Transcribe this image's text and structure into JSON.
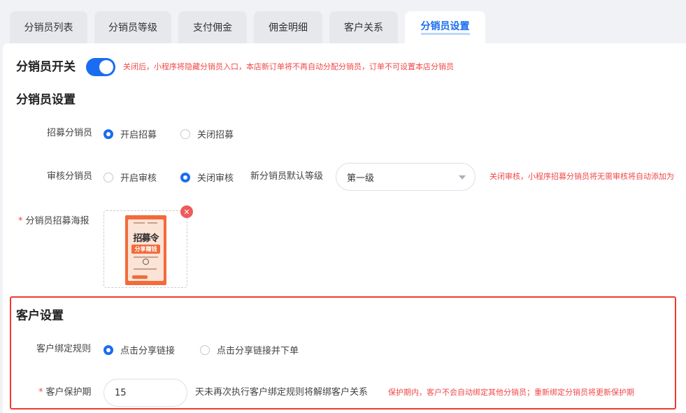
{
  "tabs": [
    {
      "label": "分销员列表"
    },
    {
      "label": "分销员等级"
    },
    {
      "label": "支付佣金"
    },
    {
      "label": "佣金明细"
    },
    {
      "label": "客户关系"
    },
    {
      "label": "分销员设置"
    }
  ],
  "switch_section": {
    "title": "分销员开关",
    "toggle_on": true,
    "note": "关闭后，小程序将隐藏分销员入口，本店新订单将不再自动分配分销员，订单不可设置本店分销员"
  },
  "distributor_settings": {
    "title": "分销员设置",
    "recruit": {
      "label": "招募分销员",
      "options": [
        "开启招募",
        "关闭招募"
      ],
      "selected": 0
    },
    "review": {
      "label": "审核分销员",
      "options": [
        "开启审核",
        "关闭审核"
      ],
      "selected": 1
    },
    "default_level": {
      "label": "新分销员默认等级",
      "value": "第一级"
    },
    "review_note": "关闭审核，小程序招募分销员将无需审核将自动添加为",
    "poster": {
      "label": "分销员招募海报",
      "required_mark": "*",
      "poster_title": "招募令",
      "poster_subtitle": "分享赚钱",
      "remove_icon": "close-icon"
    }
  },
  "customer_settings": {
    "title": "客户设置",
    "binding_rule": {
      "label": "客户绑定规则",
      "options": [
        "点击分享链接",
        "点击分享链接并下单"
      ],
      "selected": 0
    },
    "protection": {
      "label": "客户保护期",
      "required_mark": "*",
      "value": "15",
      "suffix": "天未再次执行客户绑定规则将解绑客户关系",
      "note": "保护期内，客户不会自动绑定其他分销员；重新绑定分销员将更新保护期"
    }
  },
  "colors": {
    "accent": "#1a6cf0",
    "warning": "#f04848",
    "highlight_frame": "#f23a2f"
  }
}
